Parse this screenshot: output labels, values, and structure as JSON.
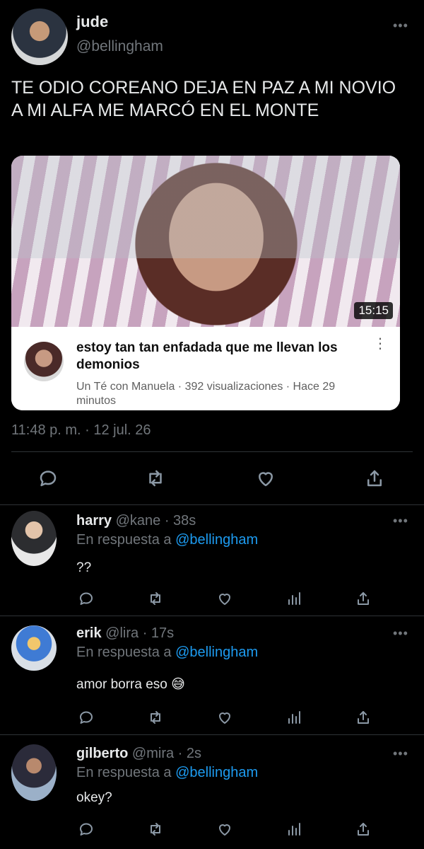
{
  "tweet": {
    "name": "jude",
    "handle": "@bellingham",
    "text": "TE ODIO COREANO DEJA EN PAZ A MI NOVIO A MI ALFA ME MARCÓ EN EL MONTE",
    "timestamp": "11:48 p. m. · 12 jul. 26",
    "more_icon": "•••",
    "card": {
      "duration": "15:15",
      "title": "estoy tan tan enfadada que me llevan los demonios",
      "meta": "Un Té con Manuela · 392 visualizaciones · Hace 29 minutos",
      "kebab_icon": "⋮"
    },
    "actions": [
      "reply-icon",
      "retweet-icon",
      "like-icon",
      "share-icon"
    ]
  },
  "replies": [
    {
      "name": "harry",
      "handle": "@kane",
      "time": "· 38s",
      "reply_prefix": "En respuesta a",
      "reply_to": "@bellingham",
      "text": "??",
      "more_icon": "•••"
    },
    {
      "name": "erik",
      "handle": "@lira",
      "time": "· 17s",
      "reply_prefix": "En respuesta a",
      "reply_to": "@bellingham",
      "text": "amor borra eso 😅",
      "more_icon": "•••"
    },
    {
      "name": "gilberto",
      "handle": "@mira",
      "time": "· 2s",
      "reply_prefix": "En respuesta a",
      "reply_to": "@bellingham",
      "text": "okey?",
      "more_icon": "•••"
    }
  ],
  "colors": {
    "background": "#000000",
    "text": "#e7e9ea",
    "muted": "#71767b",
    "link": "#1d9bf0",
    "divider": "#2f3336"
  }
}
